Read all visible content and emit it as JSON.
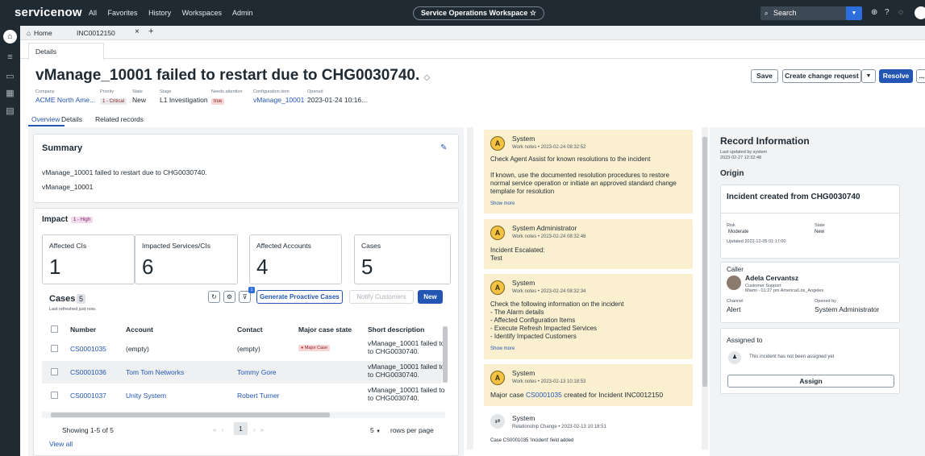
{
  "topnav": {
    "logo": "servicenow",
    "menu": [
      "All",
      "Favorites",
      "History",
      "Workspaces",
      "Admin"
    ],
    "workspace": "Service Operations Workspace ☆",
    "search_placeholder": "Search"
  },
  "tabs": {
    "home": "Home",
    "record": "INC0012150",
    "close": "×",
    "add": "+"
  },
  "subtab": "Details",
  "record": {
    "title": "vManage_10001 failed to restart due to CHG0030740.",
    "fields": [
      {
        "label": "Company",
        "value": "ACME North Ame..."
      },
      {
        "label": "Priority",
        "value": "1 - Critical"
      },
      {
        "label": "State",
        "value": "New"
      },
      {
        "label": "Stage",
        "value": "L1 Investigation"
      },
      {
        "label": "Needs attention",
        "value": "true"
      },
      {
        "label": "Configuration item",
        "value": "vManage_10001"
      },
      {
        "label": "Opened",
        "value": "2023-01-24 10:16..."
      }
    ]
  },
  "actions": {
    "save": "Save",
    "create_change": "Create change request",
    "resolve": "Resolve",
    "more": "..."
  },
  "overview_tabs": [
    "Overview",
    "Details",
    "Related records"
  ],
  "summary": {
    "title": "Summary",
    "line1": "vManage_10001 failed to restart due to CHG0030740.",
    "line2": "vManage_10001"
  },
  "impact": {
    "title": "Impact",
    "badge": "1 - High",
    "boxes": [
      {
        "label": "Affected CIs",
        "value": "1"
      },
      {
        "label": "Impacted Services/CIs",
        "value": "6"
      },
      {
        "label": "Affected Accounts",
        "value": "4"
      },
      {
        "label": "Cases",
        "value": "5"
      }
    ]
  },
  "cases": {
    "title": "Cases",
    "count": "5",
    "refreshed": "Last refreshed just now.",
    "filter_badge": "1",
    "generate": "Generate Proactive Cases",
    "notify": "Notify Customers",
    "new": "New",
    "columns": [
      "Number",
      "Account",
      "Contact",
      "Major case state",
      "Short description"
    ],
    "rows": [
      {
        "number": "CS0001035",
        "account": "(empty)",
        "contact": "(empty)",
        "state": "Major Case",
        "desc1": "vManage_10001 failed to",
        "desc2": "to CHG0030740."
      },
      {
        "number": "CS0001036",
        "account": "Tom Tom Networks",
        "contact": "Tommy Gore",
        "state": "",
        "desc1": "vManage_10001 failed to",
        "desc2": "to CHG0030740."
      },
      {
        "number": "CS0001037",
        "account": "Unity System",
        "contact": "Robert Turner",
        "state": "",
        "desc1": "vManage_10001 failed to",
        "desc2": "to CHG0030740."
      }
    ],
    "showing": "Showing 1-5 of 5",
    "page": "1",
    "rows_count": "5",
    "rows_per_page": "rows per page",
    "view_all": "View all"
  },
  "activity": [
    {
      "initial": "A",
      "name": "System",
      "meta": "Work notes • 2023-02-24 08:32:52",
      "body": [
        "Check Agent Assist for known resolutions to the incident",
        "",
        "If known, use the documented resolution procedures to restore",
        "normal service operation or initiate an approved standard change",
        "template for resolution"
      ],
      "show_more": "Show more"
    },
    {
      "initial": "A",
      "name": "System Administrator",
      "meta": "Work notes • 2023-02-24 08:32:48",
      "body": [
        "Incident Escalated:",
        "Test"
      ],
      "show_more": ""
    },
    {
      "initial": "A",
      "name": "System",
      "meta": "Work notes • 2023-02-24 08:32:34",
      "body": [
        "Check the following information on the incident",
        "- The Alarm details",
        "- Affected Configuration Items",
        "- Execute Refresh Impacted Services",
        "- Identify Impacted Customers"
      ],
      "show_more": "Show more"
    },
    {
      "initial": "A",
      "name": "System",
      "meta": "Work notes • 2023-02-13 10:18:53",
      "body_prefix": "Major case ",
      "body_link": "CS0001035",
      "body_suffix": " created for Incident INC0012150"
    },
    {
      "name": "System",
      "meta": "Relationship Change • 2023-02-13 10:18:51",
      "body": [
        "Case CS0001035 'Incident' field added"
      ]
    }
  ],
  "record_info": {
    "title": "Record Information",
    "updated_by": "Last updated by system",
    "updated_at": "2023-02-27 12:32:48",
    "origin": "Origin",
    "origin_card": {
      "title": "Incident created from CHG0030740",
      "risk_label": "Risk",
      "risk": "Moderate",
      "state_label": "State",
      "state": "New",
      "updated": "Updated 2022-12-05 01:17:00"
    },
    "caller": {
      "label": "Caller",
      "name": "Adela Cervantsz",
      "role": "Customer Support",
      "location": "Miami - 01:27 pm America/Los_Angeles",
      "channel_label": "Channel",
      "channel": "Alert",
      "opened_label": "Opened by",
      "opened": "System Administrator"
    },
    "assigned": {
      "label": "Assigned to",
      "text": "This incident has not been assigned yet",
      "button": "Assign"
    }
  },
  "colors": {
    "nav": "#1f2a33",
    "accent": "#2c6edb",
    "note": "#faf0cf",
    "critical": "#f7d6d6"
  }
}
